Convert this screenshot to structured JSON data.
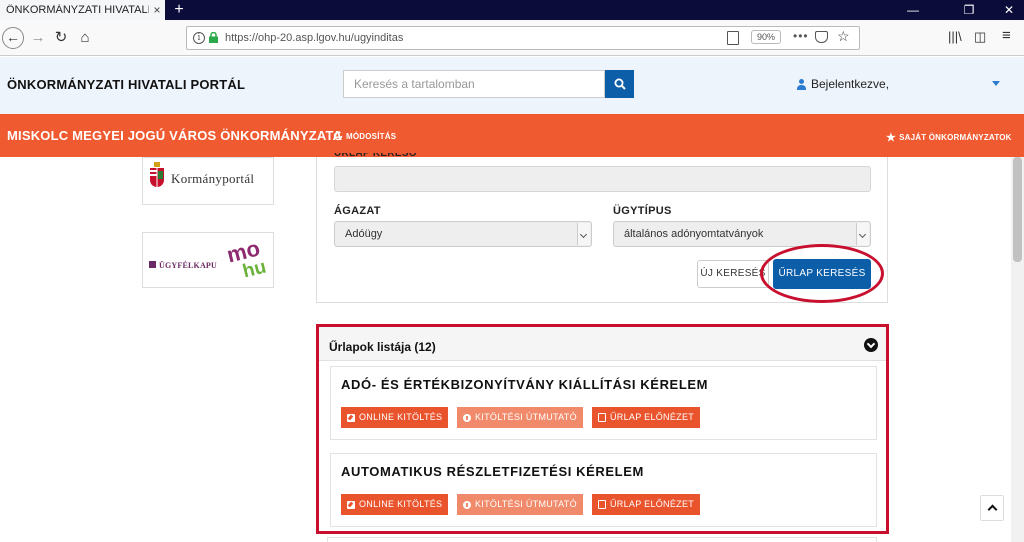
{
  "browser": {
    "tab_title": "ÖNKORMÁNYZATI HIVATALI PORTÁ",
    "tab_close": "×",
    "new_tab": "+",
    "url": "https://ohp-20.asp.lgov.hu/ugyinditas",
    "zoom": "90%",
    "window_controls": [
      "—",
      "❐",
      "✕"
    ]
  },
  "header": {
    "site_title": "ÖNKORMÁNYZATI HIVATALI PORTÁL",
    "search_placeholder": "Keresés a tartalomban",
    "user_label": "Bejelentkezve,"
  },
  "banner": {
    "municipality": "MISKOLC MEGYEI JOGÚ VÁROS ÖNKORMÁNYZATA",
    "modify_label": "MÓDOSÍTÁS",
    "own_label": "SAJÁT ÖNKORMÁNYZATOK"
  },
  "sidebar": {
    "kormanyportal": "Kormányportál",
    "ugyfelkapu": "ÜGYFÉLKAPU",
    "mo": "mo",
    "hu": "hu"
  },
  "search_form": {
    "cut_label": "ŰRLAP KERESŐ",
    "sector_label": "ÁGAZAT",
    "sector_value": "Adóügy",
    "casetype_label": "ÜGYTÍPUS",
    "casetype_value": "általános adónyomtatványok",
    "new_search": "ÚJ KERESÉS",
    "form_search": "ŰRLAP KERESÉS"
  },
  "forms_list": {
    "title": "Űrlapok listája (12)",
    "items": [
      {
        "title": "ADÓ- ÉS ÉRTÉKBIZONYÍTVÁNY KIÁLLÍTÁSI KÉRELEM",
        "online": "ONLINE KITÖLTÉS",
        "guide": "KITÖLTÉSI ÚTMUTATÓ",
        "preview": "ŰRLAP ELŐNÉZET"
      },
      {
        "title": "AUTOMATIKUS RÉSZLETFIZETÉSI KÉRELEM",
        "online": "ONLINE KITÖLTÉS",
        "guide": "KITÖLTÉSI ÚTMUTATÓ",
        "preview": "ŰRLAP ELŐNÉZET"
      }
    ]
  },
  "colors": {
    "banner": "#f05a30",
    "primary_blue": "#0d5ea8",
    "highlight_red": "#c8102e",
    "action_orange": "#e9542d"
  }
}
